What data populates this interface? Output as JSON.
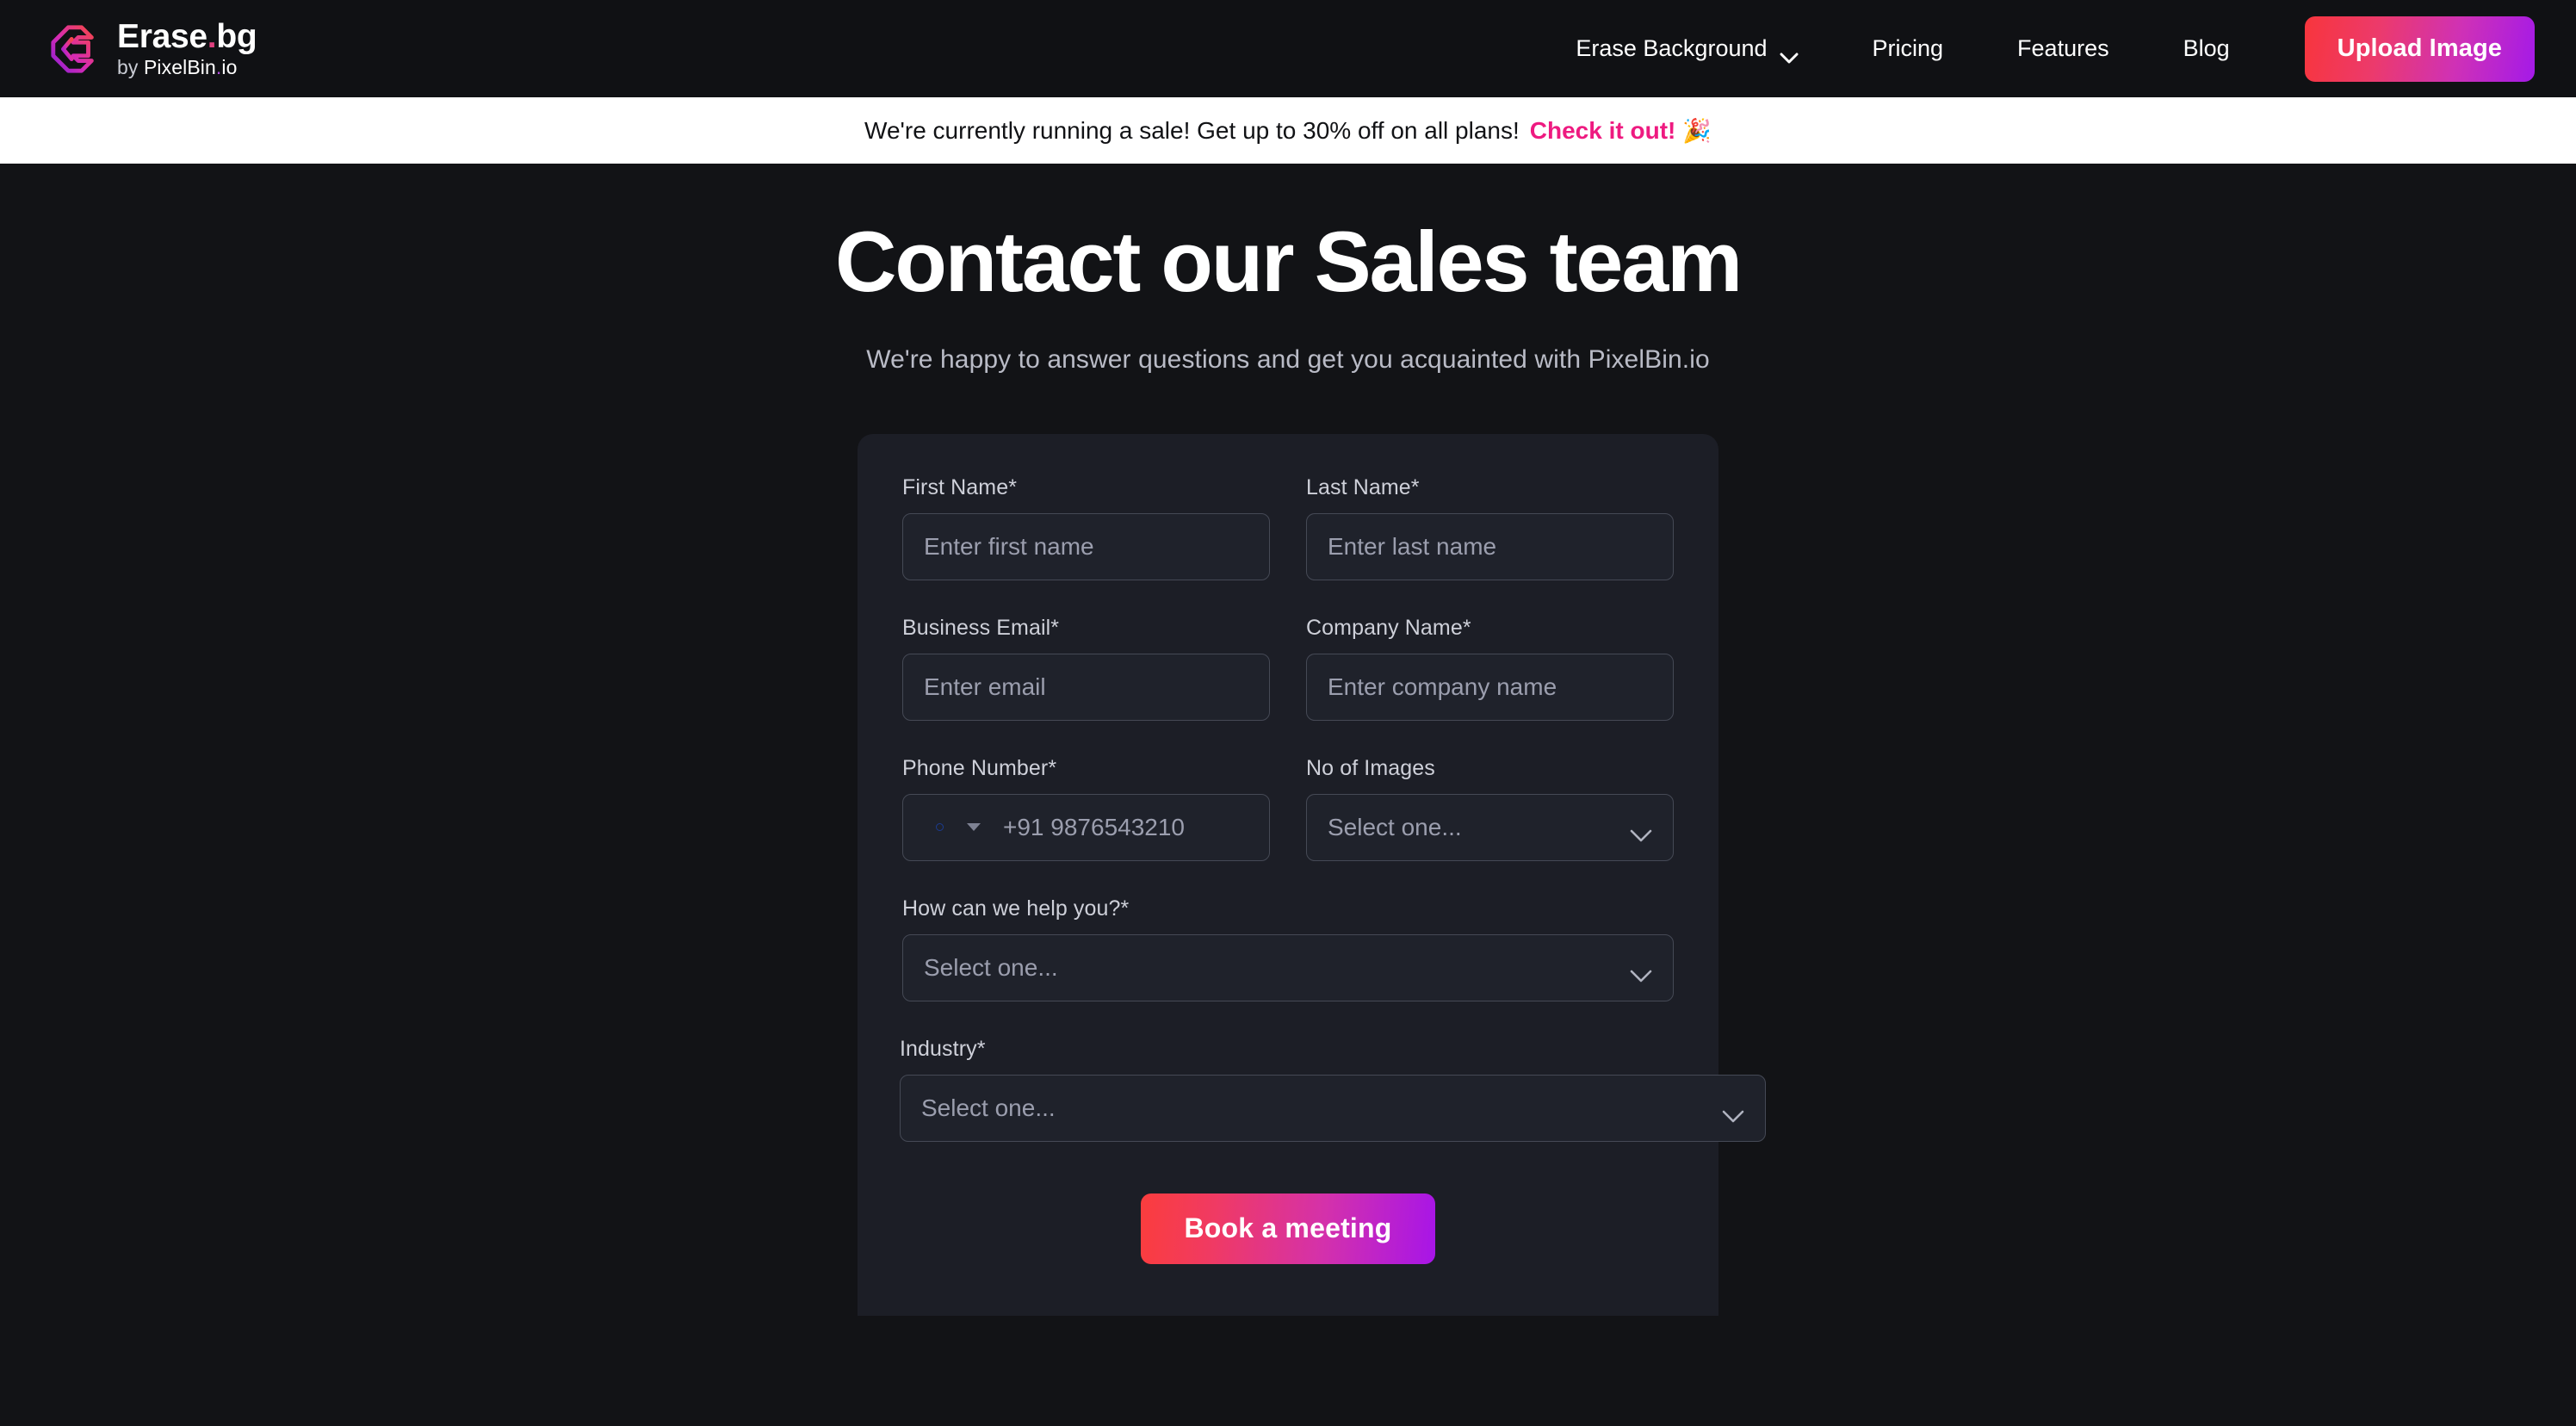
{
  "header": {
    "brand": {
      "name_main": "Erase",
      "name_dot": ".",
      "name_ext": "bg",
      "sub_by": "by ",
      "sub_name": "PixelBin",
      "sub_dot": ".",
      "sub_ext": "io",
      "logo_icon": "erasebg-diamond-logo",
      "gradient_start": "#b32bd6",
      "gradient_end": "#f3434f"
    },
    "nav": [
      {
        "label": "Erase Background",
        "has_dropdown": true,
        "icon": "chevron-down-icon"
      },
      {
        "label": "Pricing",
        "has_dropdown": false
      },
      {
        "label": "Features",
        "has_dropdown": false
      },
      {
        "label": "Blog",
        "has_dropdown": false
      }
    ],
    "upload_button": {
      "label": "Upload Image",
      "gradient_start": "#f8353c",
      "gradient_end": "#a41ae8"
    }
  },
  "banner": {
    "text": "We're currently running a sale! Get up to 30% off on all plans!",
    "link_label": "Check it out!",
    "link_color": "#ee1a80",
    "emoji": "🎉",
    "background": "#ffffff",
    "text_color": "#111215"
  },
  "main": {
    "title": "Contact our Sales team",
    "subtitle": "We're happy to answer questions and get you acquainted with PixelBin.io"
  },
  "form": {
    "row1": [
      {
        "label": "First Name*",
        "placeholder": "Enter first name",
        "value": "",
        "type": "text"
      },
      {
        "label": "Last Name*",
        "placeholder": "Enter last name",
        "value": "",
        "type": "text"
      }
    ],
    "row2": [
      {
        "label": "Business Email*",
        "placeholder": "Enter email",
        "value": "",
        "type": "email"
      },
      {
        "label": "Company Name*",
        "placeholder": "Enter company name",
        "value": "",
        "type": "text"
      }
    ],
    "phone": {
      "label": "Phone Number*",
      "placeholder": "+91 9876543210",
      "value": "",
      "country_flag": "india-flag-icon",
      "country_caret": "caret-down-icon"
    },
    "no_of_images": {
      "label": "No of Images",
      "selected": "Select one...",
      "icon": "chevron-down-icon"
    },
    "how_can_we_help": {
      "label": "How can we help you?*",
      "selected": "Select one...",
      "icon": "chevron-down-icon"
    },
    "industry": {
      "label": "Industry*",
      "selected": "Select one...",
      "icon": "chevron-down-icon"
    },
    "submit": {
      "label": "Book a meeting",
      "gradient_start": "#fb3d3d",
      "gradient_end": "#a715e8"
    },
    "card_background": "#1c1e26"
  },
  "theme": {
    "page_background": "#121316",
    "header_background": "#101114",
    "input_background": "#1f222b",
    "input_border": "#454955",
    "placeholder_color": "#9b9eae",
    "label_color": "#ced0d9"
  }
}
